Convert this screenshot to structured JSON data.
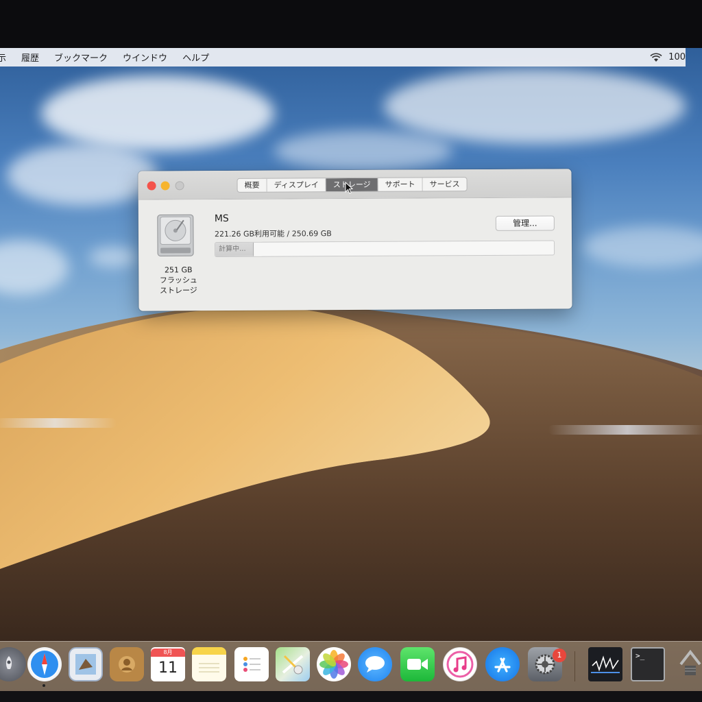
{
  "menubar": {
    "items": [
      "示",
      "履歴",
      "ブックマーク",
      "ウインドウ",
      "ヘルプ"
    ],
    "battery_text": "100"
  },
  "window": {
    "tabs": [
      "概要",
      "ディスプレイ",
      "ストレージ",
      "サポート",
      "サービス"
    ],
    "active_tab": "ストレージ",
    "disk": {
      "name": "MS",
      "availability": "221.26 GB利用可能 / 250.69 GB",
      "label_lines": [
        "251 GB",
        "フラッシュ",
        "ストレージ"
      ],
      "bar_status": "計算中...",
      "manage_button": "管理..."
    }
  },
  "dock": {
    "calendar_month": "8月",
    "calendar_day": "11",
    "badge": "1",
    "icons": [
      "launchpad-icon",
      "safari-icon",
      "mail-icon",
      "contacts-icon",
      "calendar-icon",
      "notes-icon",
      "reminders-icon",
      "maps-icon",
      "photos-icon",
      "messages-icon",
      "facetime-icon",
      "itunes-icon",
      "app-store-icon",
      "system-preferences-icon",
      "stocks-icon",
      "terminal-icon",
      "system-information-icon"
    ]
  }
}
